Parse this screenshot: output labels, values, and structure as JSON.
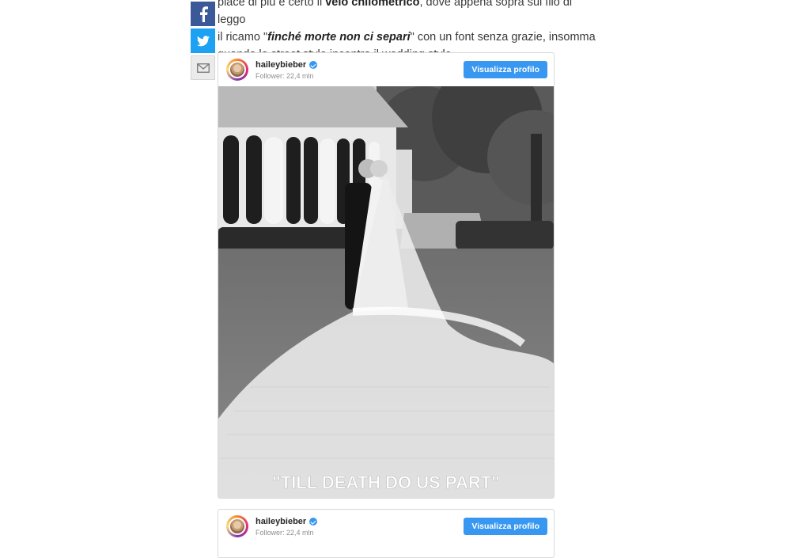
{
  "share": {
    "facebook_icon": "facebook-icon",
    "twitter_icon": "twitter-icon",
    "email_icon": "envelope-icon",
    "colors": {
      "facebook": "#3b5998",
      "twitter": "#1da1f2",
      "email": "#ebebeb"
    }
  },
  "article": {
    "line1_pre": "piace di più è certo il ",
    "line1_bold": "velo chilometrico",
    "line1_post": ", dove appena sopra sul filo di leggo",
    "line2_pre": "il ricamo \"",
    "line2_bolditalic": "finché morte non ci separi",
    "line2_post": "\" con un font senza grazie, insomma",
    "line3": "quando lo street style incontra il wedding style."
  },
  "instagram_posts": [
    {
      "username": "haileybieber",
      "followers": "Follower: 22,4 mln",
      "view_profile_label": "Visualizza profilo",
      "photo_caption_overlay": "\"TILL DEATH DO US PART\""
    },
    {
      "username": "haileybieber",
      "followers": "Follower: 22,4 mln",
      "view_profile_label": "Visualizza profilo"
    }
  ],
  "colors": {
    "instagram_button": "#3897f0",
    "text": "#3a3a3a"
  }
}
